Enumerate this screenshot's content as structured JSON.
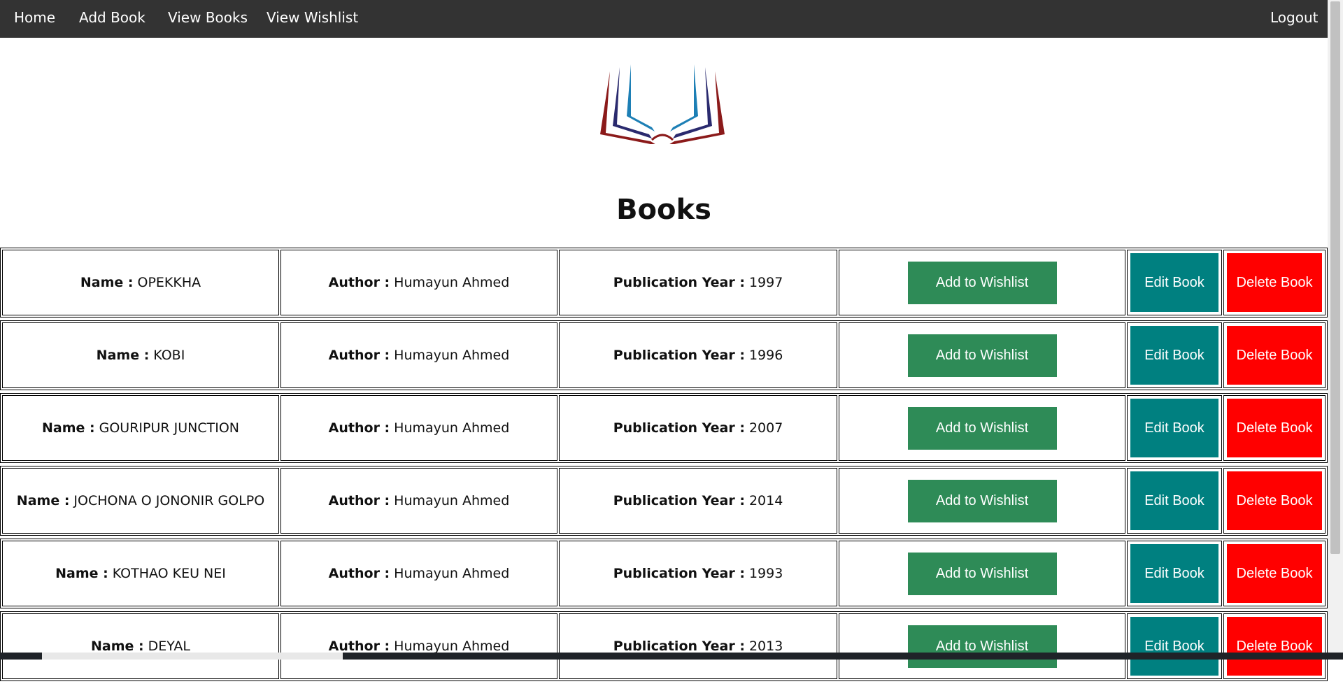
{
  "nav": {
    "home": "Home",
    "add_book": "Add Book",
    "view_books": "View Books",
    "view_wishlist": "View Wishlist",
    "logout": "Logout"
  },
  "page_title": "Books",
  "labels": {
    "name": "Name :",
    "author": "Author :",
    "year": "Publication Year :",
    "add_to_wishlist": "Add to Wishlist",
    "edit_book": "Edit Book",
    "delete_book": "Delete Book"
  },
  "books": [
    {
      "name": "OPEKKHA",
      "author": "Humayun Ahmed",
      "year": "1997"
    },
    {
      "name": "KOBI",
      "author": "Humayun Ahmed",
      "year": "1996"
    },
    {
      "name": "GOURIPUR JUNCTION",
      "author": "Humayun Ahmed",
      "year": "2007"
    },
    {
      "name": "JOCHONA O JONONIR GOLPO",
      "author": "Humayun Ahmed",
      "year": "2014"
    },
    {
      "name": "KOTHAO KEU NEI",
      "author": "Humayun Ahmed",
      "year": "1993"
    },
    {
      "name": "DEYAL",
      "author": "Humayun Ahmed",
      "year": "2013"
    }
  ],
  "colors": {
    "navbar": "#333333",
    "wishlist_button": "#2e8b57",
    "edit_button": "#008080",
    "delete_button": "#ff0000"
  },
  "icons": {
    "logo": "open-book-logo"
  }
}
